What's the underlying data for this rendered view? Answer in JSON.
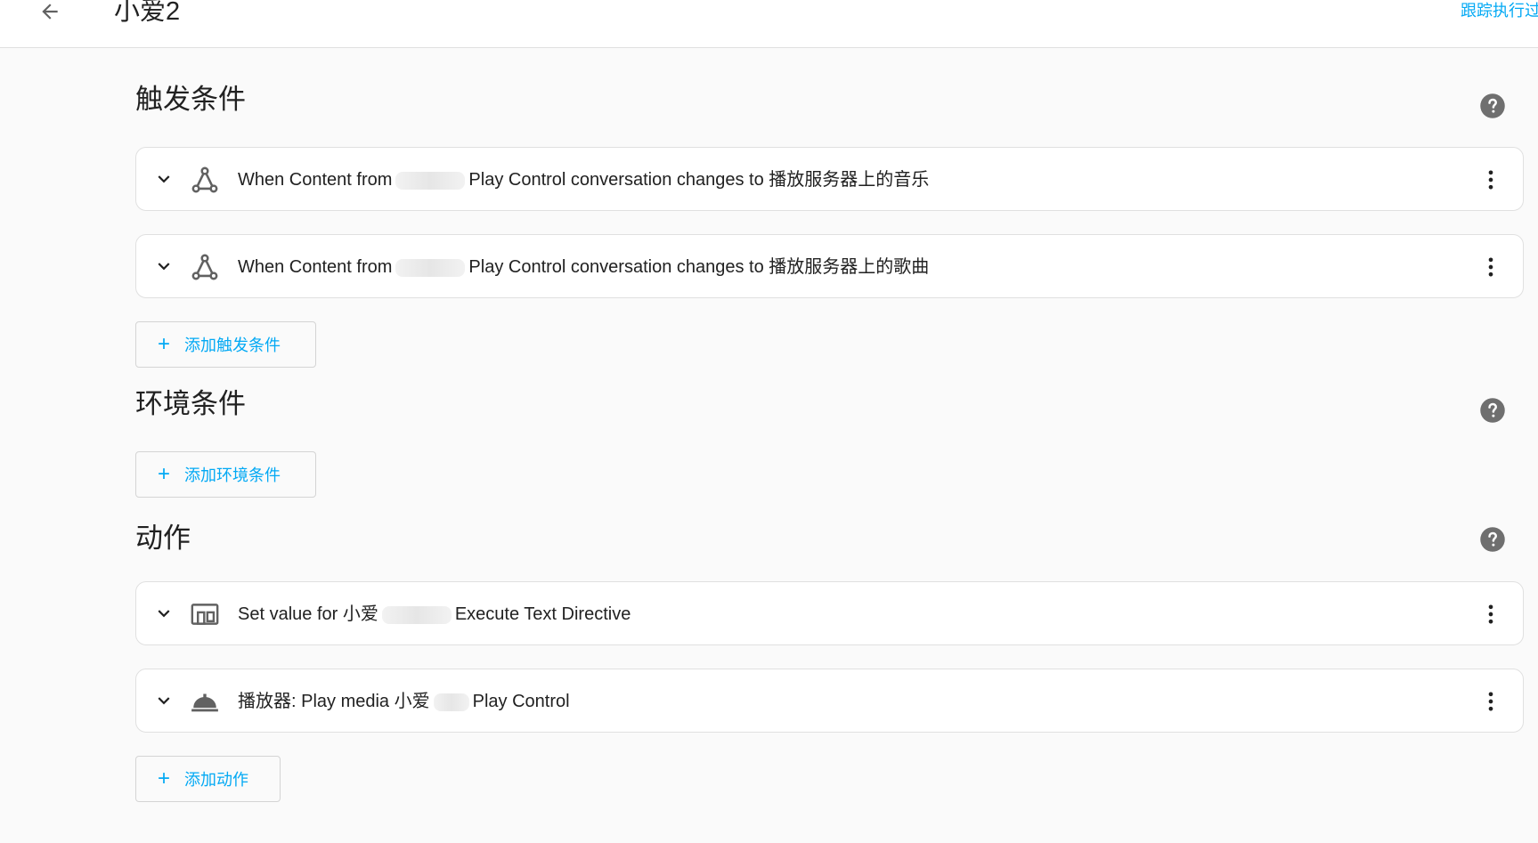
{
  "header": {
    "title": "小爱2",
    "trace_label": "跟踪执行过"
  },
  "sections": {
    "triggers": {
      "title": "触发条件",
      "items": [
        {
          "prefix": "When Content from",
          "suffix": "Play Control conversation changes to 播放服务器上的音乐"
        },
        {
          "prefix": "When Content from",
          "suffix": "Play Control conversation changes to 播放服务器上的歌曲"
        }
      ],
      "add_label": "添加触发条件"
    },
    "conditions": {
      "title": "环境条件",
      "add_label": "添加环境条件"
    },
    "actions": {
      "title": "动作",
      "items": [
        {
          "prefix": "Set value for 小爱",
          "suffix": "Execute Text Directive"
        },
        {
          "prefix": "播放器: Play media 小爱",
          "suffix": "Play Control"
        }
      ],
      "add_label": "添加动作"
    }
  },
  "icons": {
    "back": "arrow-left-icon",
    "help": "help-circle-icon",
    "expand": "chevron-down-icon",
    "trigger": "state-graph-icon",
    "action_device": "devices-icon",
    "action_media": "service-bell-icon",
    "more": "dots-vertical-icon",
    "add": "plus-icon"
  },
  "colors": {
    "accent": "#03a9f4",
    "icon": "#616161",
    "help": "#6f6f6f"
  }
}
